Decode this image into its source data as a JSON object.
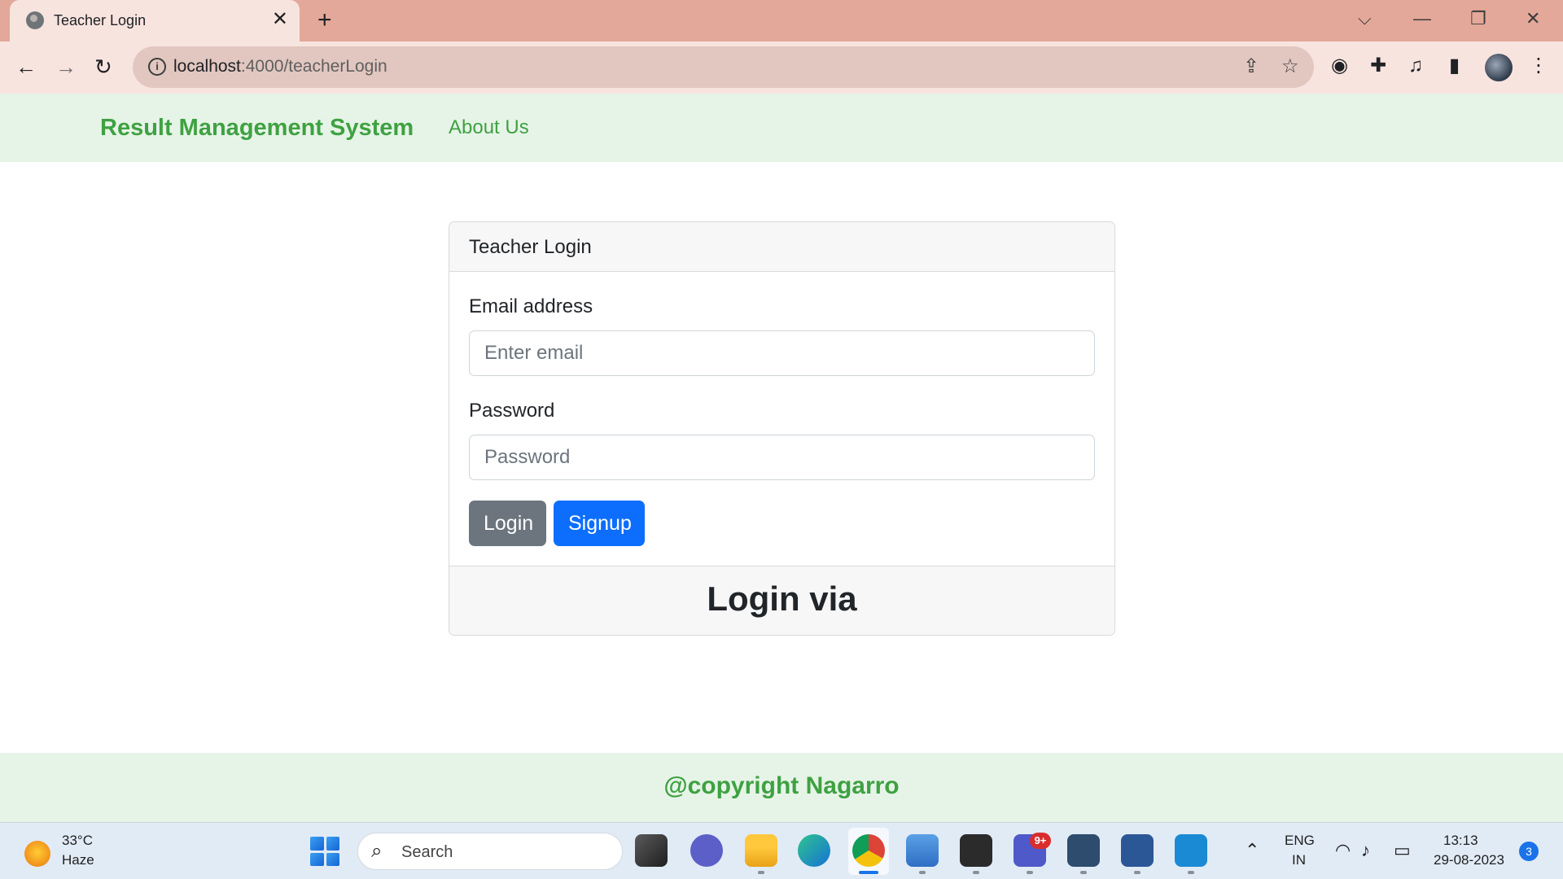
{
  "browser": {
    "tab_title": "Teacher Login",
    "tab_close": "✕",
    "new_tab": "+",
    "url_host": "localhost",
    "url_path": ":4000/teacherLogin",
    "window_controls": {
      "tab_list": "⌵",
      "minimize": "—",
      "restore": "❐",
      "close": "✕"
    },
    "nav": {
      "back": "←",
      "forward": "→",
      "reload": "↻"
    },
    "omnibox_icons": {
      "info": "i",
      "share": "⇪",
      "bookmark": "☆"
    },
    "extension_icons": {
      "extension1": "◉",
      "extensions": "✚",
      "media": "♫",
      "sidepanel": "▮",
      "menu": "⋮"
    }
  },
  "site": {
    "brand": "Result Management System",
    "about": "About Us",
    "footer": "@copyright Nagarro"
  },
  "login": {
    "header": "Teacher Login",
    "email_label": "Email address",
    "email_placeholder": "Enter email",
    "password_label": "Password",
    "password_placeholder": "Password",
    "login_button": "Login",
    "signup_button": "Signup",
    "footer_text": "Login via"
  },
  "taskbar": {
    "weather_temp": "33°C",
    "weather_desc": "Haze",
    "search_placeholder": "Search",
    "teams_badge": "9+",
    "language_top": "ENG",
    "language_bottom": "IN",
    "time": "13:13",
    "date": "29-08-2023",
    "notifications": "3"
  },
  "colors": {
    "brand_green": "#3fa142",
    "login_button": "#6c757d",
    "signup_button": "#0d6efd",
    "tabbar": "#e3a899"
  }
}
